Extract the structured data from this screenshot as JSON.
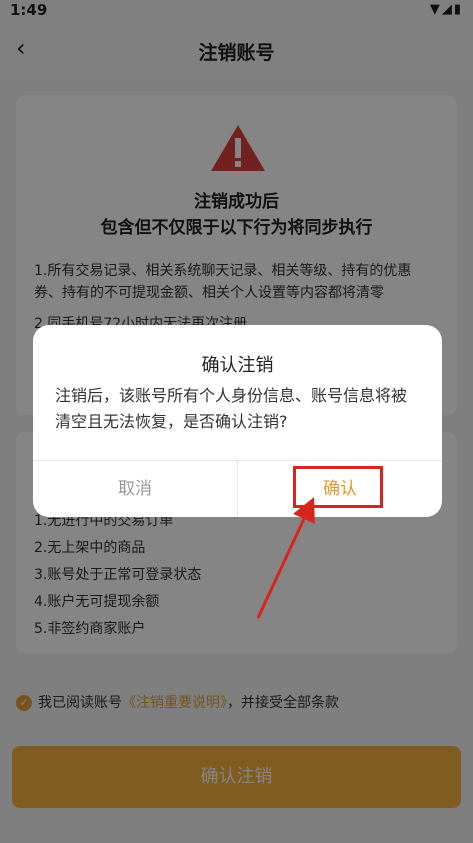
{
  "status_bar": {
    "time": "1:49",
    "icons": "▼◢▮"
  },
  "nav": {
    "back_icon": "‹",
    "title": "注销账号"
  },
  "card1": {
    "warning_icon": "warning-icon",
    "heading_line1": "注销成功后",
    "heading_line2": "包含但不仅限于以下行为将同步执行",
    "item1": "1.所有交易记录、相关系统聊天记录、相关等级、持有的优惠券、持有的不可提现金额、相关个人设置等内容都将清零",
    "item2": "2.同手机号72小时内无法再次注册"
  },
  "card2": {
    "cond1": "1.无进行中的交易订单",
    "cond2": "2.无上架中的商品",
    "cond3": "3.账号处于正常可登录状态",
    "cond4": "4.账户无可提现余额",
    "cond5": "5.非签约商家账户"
  },
  "agreement": {
    "prefix": "我已阅读账号",
    "link": "《注销重要说明》",
    "suffix": "，并接受全部条款"
  },
  "main_button": "确认注销",
  "dialog": {
    "title": "确认注销",
    "message": "注销后，该账号所有个人身份信息、账号信息将被清空且无法恢复，是否确认注销?",
    "cancel": "取消",
    "confirm": "确认"
  },
  "colors": {
    "accent": "#f3b13d",
    "highlight": "#d8241f",
    "warning": "#d9413b"
  }
}
